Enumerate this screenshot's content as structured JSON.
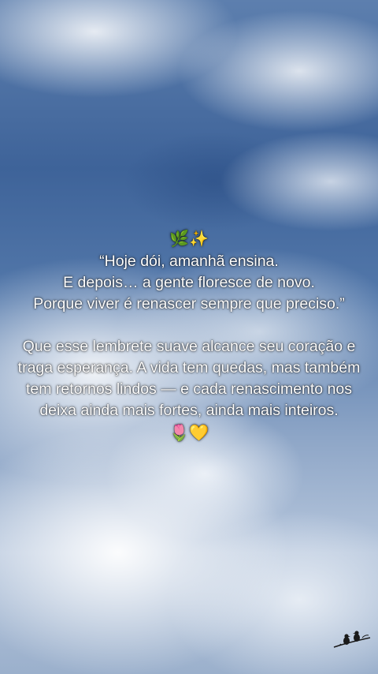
{
  "post": {
    "emoji_top": "🌿✨",
    "quote": "“Hoje dói, amanhã ensina.\nE depois… a gente floresce de novo.\nPorque viver é renascer sempre que preciso.”",
    "message": "Que esse lembrete suave alcance seu coração e traga esperança. A vida tem quedas, mas também tem retornos lindos — e cada renascimento nos deixa ainda mais fortes, ainda mais inteiros.",
    "emoji_bottom": "🌷💛"
  },
  "icons": {
    "corner": "birds-on-branch-icon"
  }
}
